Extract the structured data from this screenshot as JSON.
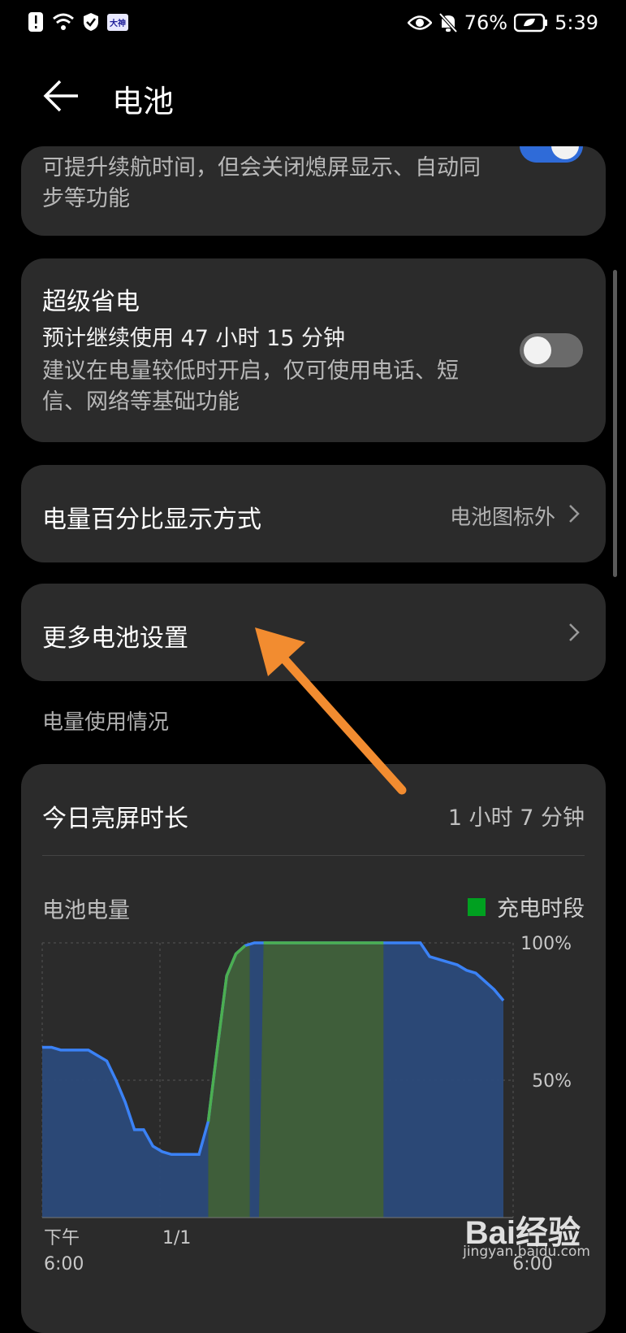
{
  "status_bar": {
    "left_icons": [
      "alert-icon",
      "wifi-icon",
      "shield-icon"
    ],
    "app_badge": "大神",
    "battery_percent": "76%",
    "time": "5:39",
    "right_icons": [
      "eye-icon",
      "mute-bell-icon",
      "battery-icon"
    ]
  },
  "header": {
    "title": "电池"
  },
  "power_saving_card": {
    "description": "可提升续航时间，但会关闭熄屏显示、自动同步等功能",
    "toggle_on": true
  },
  "super_saver_card": {
    "title": "超级省电",
    "estimate": "预计继续使用 47 小时 15 分钟",
    "description": "建议在电量较低时开启，仅可使用电话、短信、网络等基础功能",
    "toggle_on": false
  },
  "percent_display_row": {
    "title": "电量百分比显示方式",
    "value": "电池图标外"
  },
  "more_settings_row": {
    "title": "更多电池设置"
  },
  "usage_section": {
    "label": "电量使用情况"
  },
  "usage_card": {
    "screen_time_title": "今日亮屏时长",
    "screen_time_value": "1 小时 7 分钟",
    "battery_label": "电池电量",
    "legend_charging": "充电时段"
  },
  "chart_data": {
    "type": "area",
    "title": "电池电量",
    "ylim": [
      0,
      100
    ],
    "y_ticks": [
      "100%",
      "50%"
    ],
    "x_tick_labels": [
      "下午 6:00",
      "1/1",
      "6:00"
    ],
    "series": [
      {
        "name": "",
        "x": [
          0,
          2,
          4,
          6,
          8,
          10,
          12,
          14,
          16,
          18,
          20,
          22,
          24,
          26,
          28,
          30,
          32,
          34,
          36,
          38,
          40,
          42,
          44,
          46,
          48,
          50,
          52,
          54,
          56,
          58,
          60,
          62,
          64,
          66,
          68,
          70,
          72,
          74,
          76,
          78,
          80,
          82,
          84,
          86,
          88,
          90,
          92,
          94,
          96,
          98,
          100
        ],
        "values": [
          62,
          62,
          61,
          61,
          61,
          61,
          59,
          57,
          50,
          42,
          32,
          32,
          26,
          24,
          23,
          23,
          23,
          23,
          35,
          62,
          88,
          96,
          99,
          100,
          100,
          100,
          100,
          100,
          100,
          100,
          100,
          100,
          100,
          100,
          100,
          100,
          100,
          100,
          100,
          100,
          100,
          100,
          95,
          94,
          93,
          92,
          90,
          89,
          86,
          83,
          79
        ]
      }
    ],
    "charging_periods": [
      [
        36,
        45
      ],
      [
        47,
        74
      ]
    ],
    "colors": {
      "line": "#3b82f6",
      "fill": "#2b4a7a",
      "charging_line": "#4caf50",
      "charging_fill": "#3f5e3a",
      "legend": "#00a020"
    }
  },
  "annotation": {
    "arrow_color": "#f28c30"
  },
  "watermark": {
    "text": "Bai经验",
    "sub": "jingyan.baidu.com"
  }
}
